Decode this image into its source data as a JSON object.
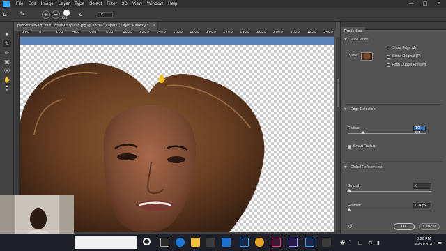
{
  "menubar": {
    "items": [
      "File",
      "Edit",
      "Image",
      "Layer",
      "Type",
      "Select",
      "Filter",
      "3D",
      "View",
      "Window",
      "Help"
    ]
  },
  "optbar": {
    "brush_size": "125",
    "angle": "0°"
  },
  "document": {
    "tab_title": "park-street-KYUtTYOal9M-unsplash.jpg @ 33.3% (Layer 0, Layer Mask/8) *",
    "ruler_labels": [
      "200",
      "0",
      "200",
      "400",
      "600",
      "800",
      "1000",
      "1200",
      "1400",
      "1600",
      "1800",
      "2000",
      "2200",
      "2400",
      "2600",
      "2800",
      "3000",
      "3200",
      "3400"
    ]
  },
  "properties": {
    "tab": "Properties",
    "view_mode_label": "View Mode",
    "view_label": "View:",
    "show_edge": "Show Edge (J)",
    "show_original": "Show Original (P)",
    "high_quality": "High Quality Preview",
    "edge_detection": "Edge Detection",
    "radius_label": "Radius:",
    "radius_value": "10 px",
    "smart_radius": "Smart Radius",
    "global_refinements": "Global Refinements",
    "smooth_label": "Smooth:",
    "smooth_value": "0",
    "feather_label": "Feather:",
    "feather_value": "0.0 px",
    "ok": "OK",
    "cancel": "Cancel",
    "radius_fraction": 0.2
  },
  "taskbar": {
    "time": "8:26 PM",
    "date": "10/30/2020"
  },
  "colors": {
    "accent": "#31a8ff",
    "selected_field": "#3a6fb3"
  }
}
